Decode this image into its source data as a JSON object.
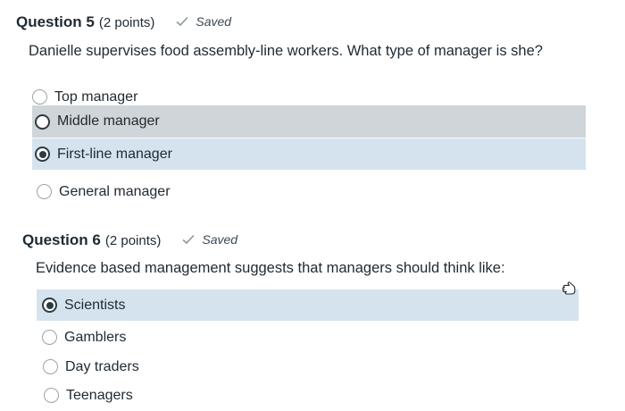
{
  "questions": [
    {
      "label": "Question 5",
      "points": "(2 points)",
      "status": "Saved",
      "prompt": "Danielle supervises food assembly-line workers. What type of manager is she?",
      "options": [
        {
          "label": "Top manager",
          "selected": false
        },
        {
          "label": "Middle manager",
          "selected": false
        },
        {
          "label": "First-line manager",
          "selected": true
        },
        {
          "label": "General manager",
          "selected": false
        }
      ]
    },
    {
      "label": "Question 6",
      "points": "(2 points)",
      "status": "Saved",
      "prompt": "Evidence based management suggests that managers should think like:",
      "options": [
        {
          "label": "Scientists",
          "selected": true
        },
        {
          "label": "Gamblers",
          "selected": false
        },
        {
          "label": "Day traders",
          "selected": false
        },
        {
          "label": "Teenagers",
          "selected": false
        }
      ]
    }
  ],
  "icons": {
    "saved": "checkmark-icon",
    "cursor": "hand-pointer-icon"
  },
  "colors": {
    "hover_row": "#cfd5d8",
    "selected_row": "#d5e3ee",
    "text": "#1f2a33"
  }
}
